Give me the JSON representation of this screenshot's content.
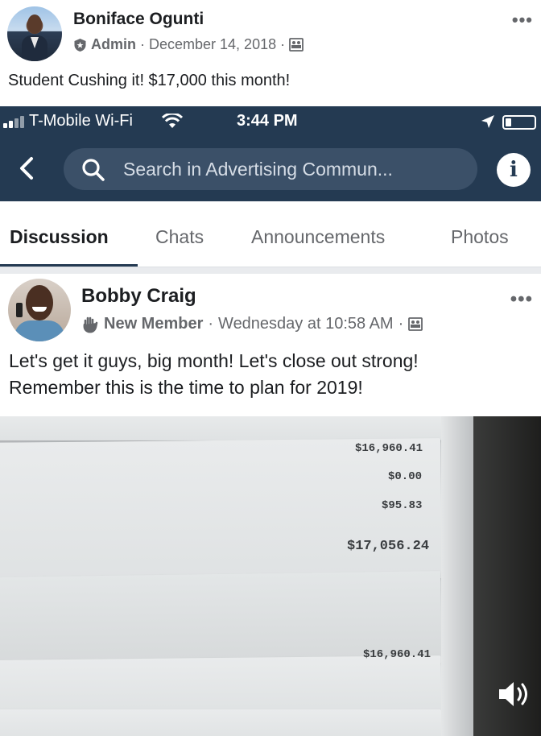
{
  "outer_post": {
    "author": "Boniface Ogunti",
    "role": "Admin",
    "date": "December 14, 2018",
    "text": "Student Cushing it! $17,000 this month!",
    "more_icon": "more-horizontal-icon"
  },
  "status_bar": {
    "carrier": "T-Mobile Wi-Fi",
    "time": "3:44 PM"
  },
  "nav": {
    "search_placeholder": "Search in Advertising Commun...",
    "info_label": "i"
  },
  "tabs": [
    {
      "label": "Discussion",
      "active": true
    },
    {
      "label": "Chats",
      "active": false
    },
    {
      "label": "Announcements",
      "active": false
    },
    {
      "label": "Photos",
      "active": false
    }
  ],
  "inner_post": {
    "author": "Bobby Craig",
    "role": "New Member",
    "date": "Wednesday at 10:58 AM",
    "text_line1": "Let's get it guys, big month! Let's close out strong!",
    "text_line2": "Remember this is the time to plan for 2019!"
  },
  "photo": {
    "amounts": [
      "$16,960.41",
      "$0.00",
      "$95.83",
      "$17,056.24",
      "$16,960.41"
    ]
  },
  "colors": {
    "nav_bg": "#243a52",
    "search_bg": "#3b5068",
    "meta_gray": "#65676b"
  }
}
